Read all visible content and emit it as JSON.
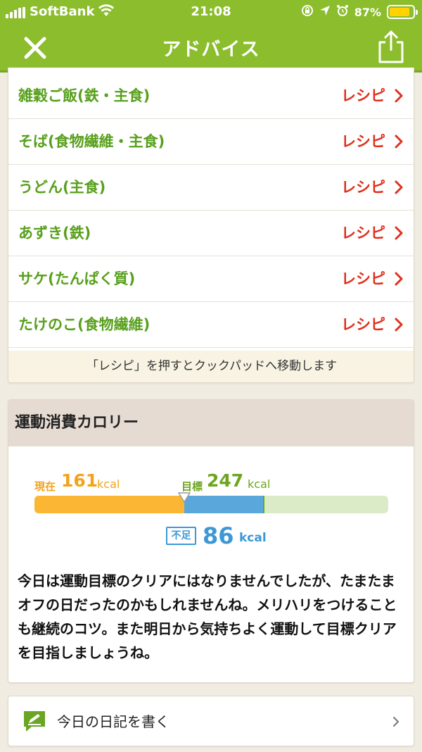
{
  "status_bar": {
    "carrier": "SoftBank",
    "time": "21:08",
    "battery": "87%",
    "battery_level": 0.87
  },
  "header": {
    "title": "アドバイス",
    "close_icon": "close-icon",
    "share_icon": "share-icon"
  },
  "recipes": {
    "items": [
      {
        "name": "雑穀ご飯(鉄・主食)",
        "link": "レシピ"
      },
      {
        "name": "そば(食物繊維・主食)",
        "link": "レシピ"
      },
      {
        "name": "うどん(主食)",
        "link": "レシピ"
      },
      {
        "name": "あずき(鉄)",
        "link": "レシピ"
      },
      {
        "name": "サケ(たんぱく質)",
        "link": "レシピ"
      },
      {
        "name": "たけのこ(食物繊維)",
        "link": "レシピ"
      }
    ],
    "note": "「レシピ」を押すとクックパッドへ移動します"
  },
  "exercise": {
    "title": "運動消費カロリー",
    "current_label": "現在",
    "current_value": "161",
    "target_label": "目標",
    "target_value": "247",
    "unit": "kcal",
    "shortfall_label": "不足",
    "shortfall_value": "86",
    "current_kcal": 161,
    "target_kcal": 247,
    "scale_max_kcal": 380,
    "advice": "今日は運動目標のクリアにはなりませんでしたが、たまたまオフの日だったのかもしれませんね。メリハリをつけることも継続のコツ。また明日から気持ちよく運動して目標クリアを目指しましょうね。"
  },
  "diary": {
    "label": "今日の日記を書く",
    "icon": "pencil-note-icon"
  },
  "colors": {
    "header_green": "#8bbd2d",
    "item_green": "#58a01c",
    "recipe_red": "#e0301e",
    "current_orange": "#fbb733",
    "shortfall_blue": "#5aa7dc",
    "track_light_green": "#dcebc7"
  }
}
